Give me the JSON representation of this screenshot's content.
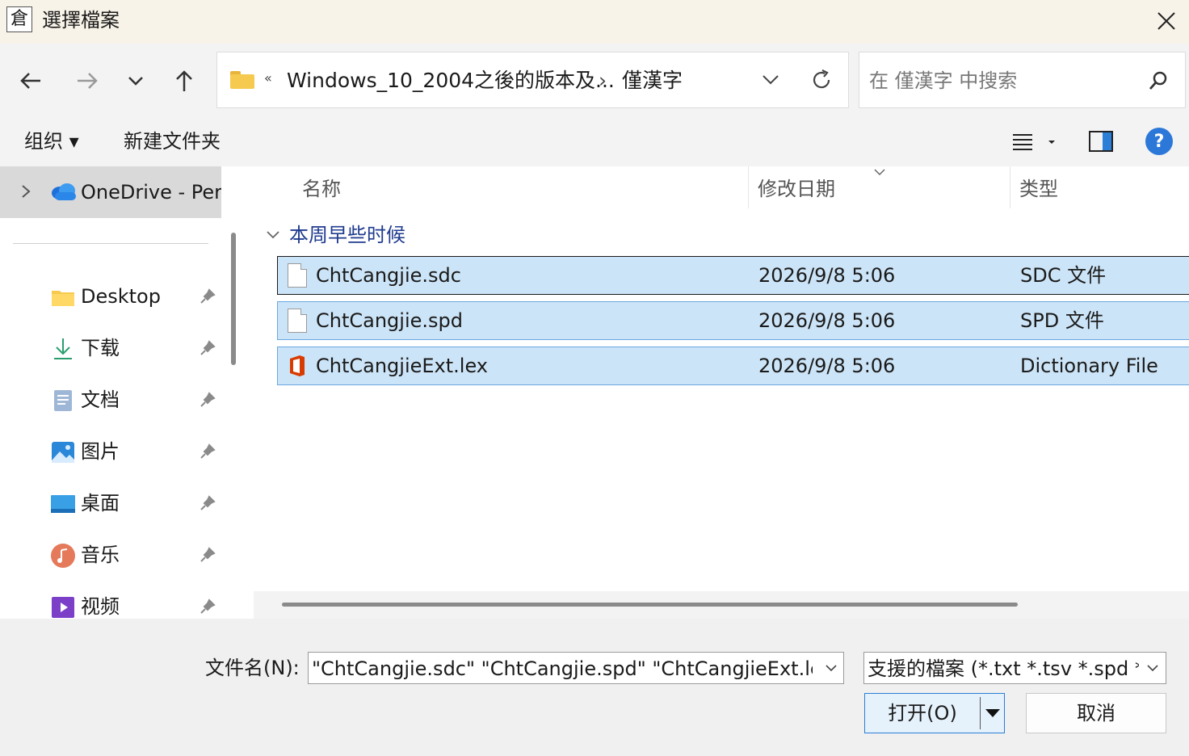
{
  "titlebar": {
    "app_icon_glyph": "倉",
    "title": "選擇檔案",
    "close_icon": "close-icon"
  },
  "navigation": {
    "back_icon": "arrow-left-icon",
    "forward_icon": "arrow-right-icon",
    "recent_icon": "chevron-down-icon",
    "up_icon": "arrow-up-icon"
  },
  "address": {
    "overflow": "«",
    "path": [
      "Windows_10_2004之後的版本及...",
      "僅漢字"
    ],
    "separator": "›"
  },
  "search": {
    "placeholder": "在 僅漢字 中搜索"
  },
  "toolbar": {
    "organize_label": "组织 ▾",
    "new_folder_label": "新建文件夹",
    "help_glyph": "?"
  },
  "sidebar": {
    "onedrive_label": "OneDrive - Personal",
    "items": [
      {
        "label": "Desktop",
        "icon": "folder-icon"
      },
      {
        "label": "下载",
        "icon": "download-icon"
      },
      {
        "label": "文档",
        "icon": "document-icon"
      },
      {
        "label": "图片",
        "icon": "pictures-icon"
      },
      {
        "label": "桌面",
        "icon": "desktop-icon"
      },
      {
        "label": "音乐",
        "icon": "music-icon"
      },
      {
        "label": "视频",
        "icon": "video-icon"
      }
    ]
  },
  "filelist": {
    "columns": {
      "name": "名称",
      "date": "修改日期",
      "type": "类型"
    },
    "group": "本周早些时候",
    "rows": [
      {
        "name": "ChtCangjie.sdc",
        "date": "2026/9/8 5:06",
        "type": "SDC 文件",
        "icon": "generic-file-icon"
      },
      {
        "name": "ChtCangjie.spd",
        "date": "2026/9/8 5:06",
        "type": "SPD 文件",
        "icon": "generic-file-icon"
      },
      {
        "name": "ChtCangjieExt.lex",
        "date": "2026/9/8 5:06",
        "type": "Dictionary File",
        "icon": "office-file-icon"
      }
    ]
  },
  "footer": {
    "filename_label": "文件名(N):",
    "filename_value": "\"ChtCangjie.sdc\" \"ChtCangjie.spd\" \"ChtCangjieExt.lex\"",
    "filter_value": "支援的檔案 (*.txt *.tsv *.spd *.lex)",
    "open_label": "打开(O)",
    "cancel_label": "取消"
  },
  "colors": {
    "titlebar_bg": "#f8f3e8",
    "selection_bg": "#cce4f7",
    "selection_border": "#6aa7e0",
    "accent": "#2b78d8"
  }
}
